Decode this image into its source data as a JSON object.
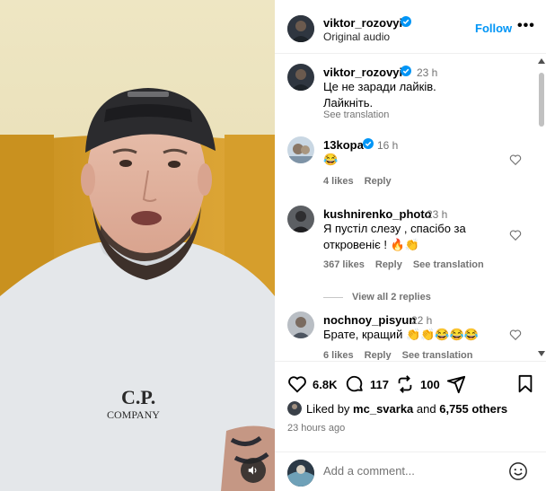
{
  "header": {
    "username": "viktor_rozovyi",
    "audio": "Original audio",
    "follow_label": "Follow",
    "more_label": "•••"
  },
  "caption": {
    "username": "viktor_rozovyi",
    "time": "23 h",
    "text_line1": "Це не заради лайків.",
    "text_line2": "Лайкніть.",
    "see_translation": "See translation"
  },
  "comments": [
    {
      "username": "13kopa",
      "time": "16 h",
      "text": "😂",
      "likes": "4 likes",
      "reply": "Reply"
    },
    {
      "username": "kushnirenko_photo",
      "time": "23 h",
      "text_line1": "Я пустіл слезу , спасібо за",
      "text_line2": "откровеніє ! 🔥👏",
      "likes": "367 likes",
      "reply": "Reply",
      "see_translation": "See translation",
      "view_replies": "View all 2 replies"
    },
    {
      "username": "nochnoy_pisyun",
      "time": "22 h",
      "text": "Брате, кращий 👏👏😂😂😂",
      "likes": "6 likes",
      "reply": "Reply",
      "see_translation": "See translation"
    }
  ],
  "actions": {
    "like_count": "6.8K",
    "comment_count": "117",
    "repost_count": "100"
  },
  "liked_by": {
    "prefix": "Liked by",
    "user": "mc_svarka",
    "and": "and",
    "others": "6,755 others"
  },
  "post_time": "23 hours ago",
  "comment_input": {
    "placeholder": "Add a comment..."
  },
  "colors": {
    "accent": "#0095f6",
    "secondary_text": "#737373",
    "verified": "#0095f6"
  },
  "icons": {
    "verified": "verified-badge-icon",
    "like": "heart-icon",
    "comment": "comment-bubble-icon",
    "repost": "repost-icon",
    "share": "paper-plane-icon",
    "save": "bookmark-icon",
    "emoji": "smiley-icon",
    "sound": "speaker-icon"
  }
}
